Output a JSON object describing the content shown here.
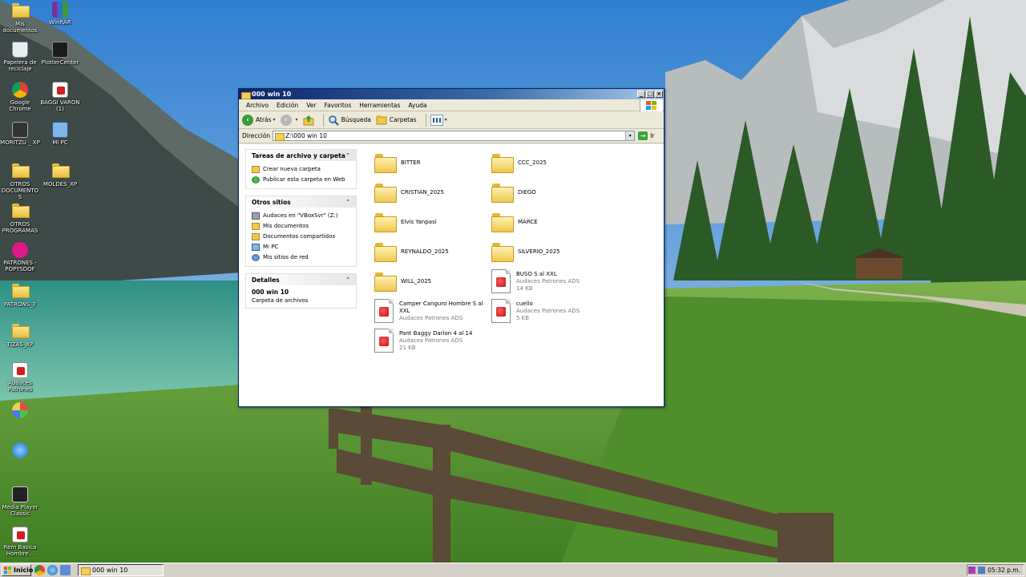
{
  "desktop": {
    "icons": [
      {
        "label": "Mis documentos",
        "kind": "folder-docs"
      },
      {
        "label": "WinRAR",
        "kind": "winrar"
      },
      {
        "label": "Papelera de reciclaje",
        "kind": "recycle"
      },
      {
        "label": "PlotterCenter",
        "kind": "plotter"
      },
      {
        "label": "Google Chrome",
        "kind": "chrome"
      },
      {
        "label": "BAGGI VARON (1)",
        "kind": "audaces"
      },
      {
        "label": "MORITZU _ XP",
        "kind": "app-dark"
      },
      {
        "label": "Mi PC",
        "kind": "mypc"
      },
      {
        "label": "OTROS DOCUMENTOS",
        "kind": "folder"
      },
      {
        "label": "MOLDES_XP",
        "kind": "folder"
      },
      {
        "label": "OTROS PROGRAMAS",
        "kind": "folder"
      },
      {
        "label": "PATRONES - POPYSDOF",
        "kind": "patrones"
      },
      {
        "label": "PATRONS_7",
        "kind": "folder"
      },
      {
        "label": "TIZAS_XP",
        "kind": "folder"
      },
      {
        "label": "Audaces Patrones",
        "kind": "audaces"
      },
      {
        "label": "",
        "kind": "multi"
      },
      {
        "label": "",
        "kind": "blue"
      },
      {
        "label": "Media Player Classic",
        "kind": "mpc"
      },
      {
        "label": "Rem Basica Hombre...",
        "kind": "audaces"
      }
    ]
  },
  "window": {
    "title": "000 win 10",
    "menu": [
      "Archivo",
      "Edición",
      "Ver",
      "Favoritos",
      "Herramientas",
      "Ayuda"
    ],
    "toolbar": {
      "back": "Atrás",
      "search": "Búsqueda",
      "folders": "Carpetas"
    },
    "address": {
      "label": "Dirección",
      "value": "Z:\\000 win 10",
      "go": "Ir"
    },
    "tasks": {
      "title": "Tareas de archivo y carpeta",
      "items": [
        "Crear nueva carpeta",
        "Publicar esta carpeta en Web"
      ]
    },
    "places": {
      "title": "Otros sitios",
      "items": [
        "Audaces en \"VBoxSvr\" (Z:)",
        "Mis documentos",
        "Documentos compartidos",
        "Mi PC",
        "Mis sitios de red"
      ]
    },
    "details": {
      "title": "Detalles",
      "name": "000 win 10",
      "type": "Carpeta de archivos"
    },
    "files": [
      {
        "name": "BITTER",
        "kind": "folder"
      },
      {
        "name": "CCC_2025",
        "kind": "folder"
      },
      {
        "name": "CRISTIAN_2025",
        "kind": "folder"
      },
      {
        "name": "DIEGO",
        "kind": "folder"
      },
      {
        "name": "Elvis Yanpasi",
        "kind": "folder"
      },
      {
        "name": "MARCE",
        "kind": "folder"
      },
      {
        "name": "REYNALDO_2025",
        "kind": "folder"
      },
      {
        "name": "SILVERIO_2025",
        "kind": "folder"
      },
      {
        "name": "WILL_2025",
        "kind": "folder"
      },
      {
        "name": "BUSO S al XXL",
        "kind": "file",
        "type": "Audaces Patrones ADS",
        "size": "14 KB"
      },
      {
        "name": "Camper Canguro Hombre S al XXL",
        "kind": "file",
        "type": "Audaces Patrones ADS",
        "size": ""
      },
      {
        "name": "cuello",
        "kind": "file",
        "type": "Audaces Patrones ADS",
        "size": "5 KB"
      },
      {
        "name": "Pant Baggy Darlon 4 al 14",
        "kind": "file",
        "type": "Audaces Patrones ADS",
        "size": "21 KB"
      }
    ]
  },
  "taskbar": {
    "start": "Inicio",
    "task": "000 win 10",
    "clock": "05:32 p.m."
  },
  "colors": {
    "title_start": "#0a246a",
    "title_end": "#a6caf0",
    "window_bg": "#ece9d8",
    "folder": "#efc750"
  }
}
